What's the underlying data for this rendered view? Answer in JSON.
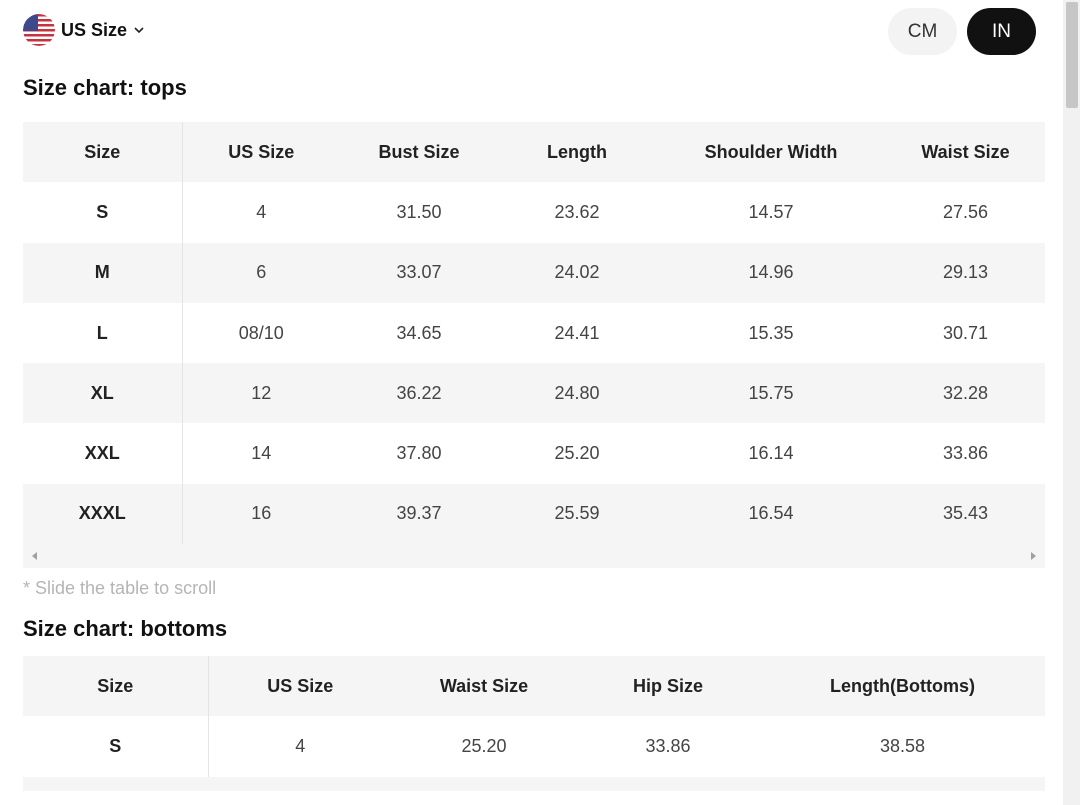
{
  "header": {
    "size_system_label": "US Size",
    "units": [
      "CM",
      "IN"
    ],
    "active_unit": "IN"
  },
  "tops": {
    "title": "Size chart: tops",
    "columns": [
      "Size",
      "US Size",
      "Bust Size",
      "Length",
      "Shoulder Width",
      "Waist Size"
    ],
    "rows": [
      [
        "S",
        "4",
        "31.50",
        "23.62",
        "14.57",
        "27.56"
      ],
      [
        "M",
        "6",
        "33.07",
        "24.02",
        "14.96",
        "29.13"
      ],
      [
        "L",
        "08/10",
        "34.65",
        "24.41",
        "15.35",
        "30.71"
      ],
      [
        "XL",
        "12",
        "36.22",
        "24.80",
        "15.75",
        "32.28"
      ],
      [
        "XXL",
        "14",
        "37.80",
        "25.20",
        "16.14",
        "33.86"
      ],
      [
        "XXXL",
        "16",
        "39.37",
        "25.59",
        "16.54",
        "35.43"
      ]
    ],
    "scroll_hint": "* Slide the table to scroll"
  },
  "bottoms": {
    "title": "Size chart: bottoms",
    "columns": [
      "Size",
      "US Size",
      "Waist Size",
      "Hip Size",
      "Length(Bottoms)"
    ],
    "rows": [
      [
        "S",
        "4",
        "25.20",
        "33.86",
        "38.58"
      ]
    ]
  },
  "colors": {
    "active_toggle": "#111111",
    "inactive_toggle": "#f3f3f3",
    "row_shade": "#f5f5f5",
    "hint_text": "#b5b5b5"
  }
}
